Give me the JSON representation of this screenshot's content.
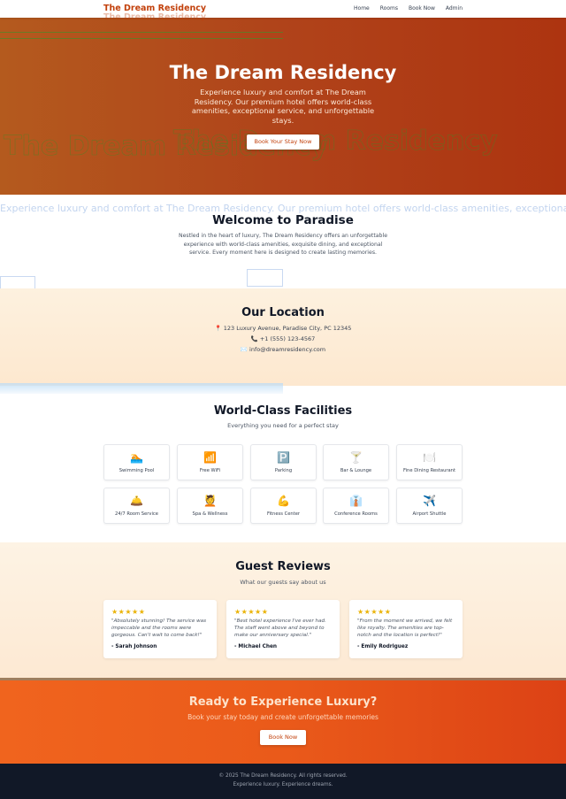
{
  "nav": {
    "brand": "The Dream Residency",
    "links": [
      "Home",
      "Rooms",
      "Book Now",
      "Admin"
    ]
  },
  "hero": {
    "title": "The Dream Residency",
    "subtitle": "Experience luxury and comfort at The Dream Residency. Our premium hotel offers world-class amenities, exceptional service, and unforgettable stays.",
    "button": "Book Your Stay Now"
  },
  "welcome": {
    "title": "Welcome to Paradise",
    "text": "Nestled in the heart of luxury, The Dream Residency offers an unforgettable experience with world-class amenities, exquisite dining, and exceptional service. Every moment here is designed to create lasting memories."
  },
  "location": {
    "title": "Our Location",
    "address": "📍 123 Luxury Avenue, Paradise City, PC 12345",
    "phone": "📞 +1 (555) 123-4567",
    "email": "✉️ info@dreamresidency.com"
  },
  "facilities": {
    "title": "World-Class Facilities",
    "subtitle": "Everything you need for a perfect stay",
    "items": [
      {
        "icon": "🏊",
        "label": "Swimming Pool"
      },
      {
        "icon": "📶",
        "label": "Free WiFi"
      },
      {
        "icon": "🅿️",
        "label": "Parking"
      },
      {
        "icon": "🍸",
        "label": "Bar & Lounge"
      },
      {
        "icon": "🍽️",
        "label": "Fine Dining Restaurant"
      },
      {
        "icon": "🛎️",
        "label": "24/7 Room Service"
      },
      {
        "icon": "💆",
        "label": "Spa & Wellness"
      },
      {
        "icon": "💪",
        "label": "Fitness Center"
      },
      {
        "icon": "👔",
        "label": "Conference Rooms"
      },
      {
        "icon": "✈️",
        "label": "Airport Shuttle"
      }
    ]
  },
  "reviews": {
    "title": "Guest Reviews",
    "subtitle": "What our guests say about us",
    "items": [
      {
        "stars": "★★★★★",
        "text": "\"Absolutely stunning! The service was impeccable and the rooms were gorgeous. Can't wait to come back!\"",
        "author": "- Sarah Johnson"
      },
      {
        "stars": "★★★★★",
        "text": "\"Best hotel experience I've ever had. The staff went above and beyond to make our anniversary special.\"",
        "author": "- Michael Chen"
      },
      {
        "stars": "★★★★★",
        "text": "\"From the moment we arrived, we felt like royalty. The amenities are top-notch and the location is perfect!\"",
        "author": "- Emily Rodriguez"
      }
    ]
  },
  "cta": {
    "title": "Ready to Experience Luxury?",
    "subtitle": "Book your stay today and create unforgettable memories",
    "button": "Book Now"
  },
  "footer": {
    "copyright": "© 2025 The Dream Residency. All rights reserved.",
    "tagline": "Experience luxury. Experience dreams."
  },
  "colors": {
    "accent": "#c2410c",
    "hero_start": "#b45a1e",
    "hero_end": "#ad3410",
    "cta_start": "#f0641e",
    "cta_end": "#dc4215",
    "footer": "#111827",
    "star": "#eab308"
  }
}
